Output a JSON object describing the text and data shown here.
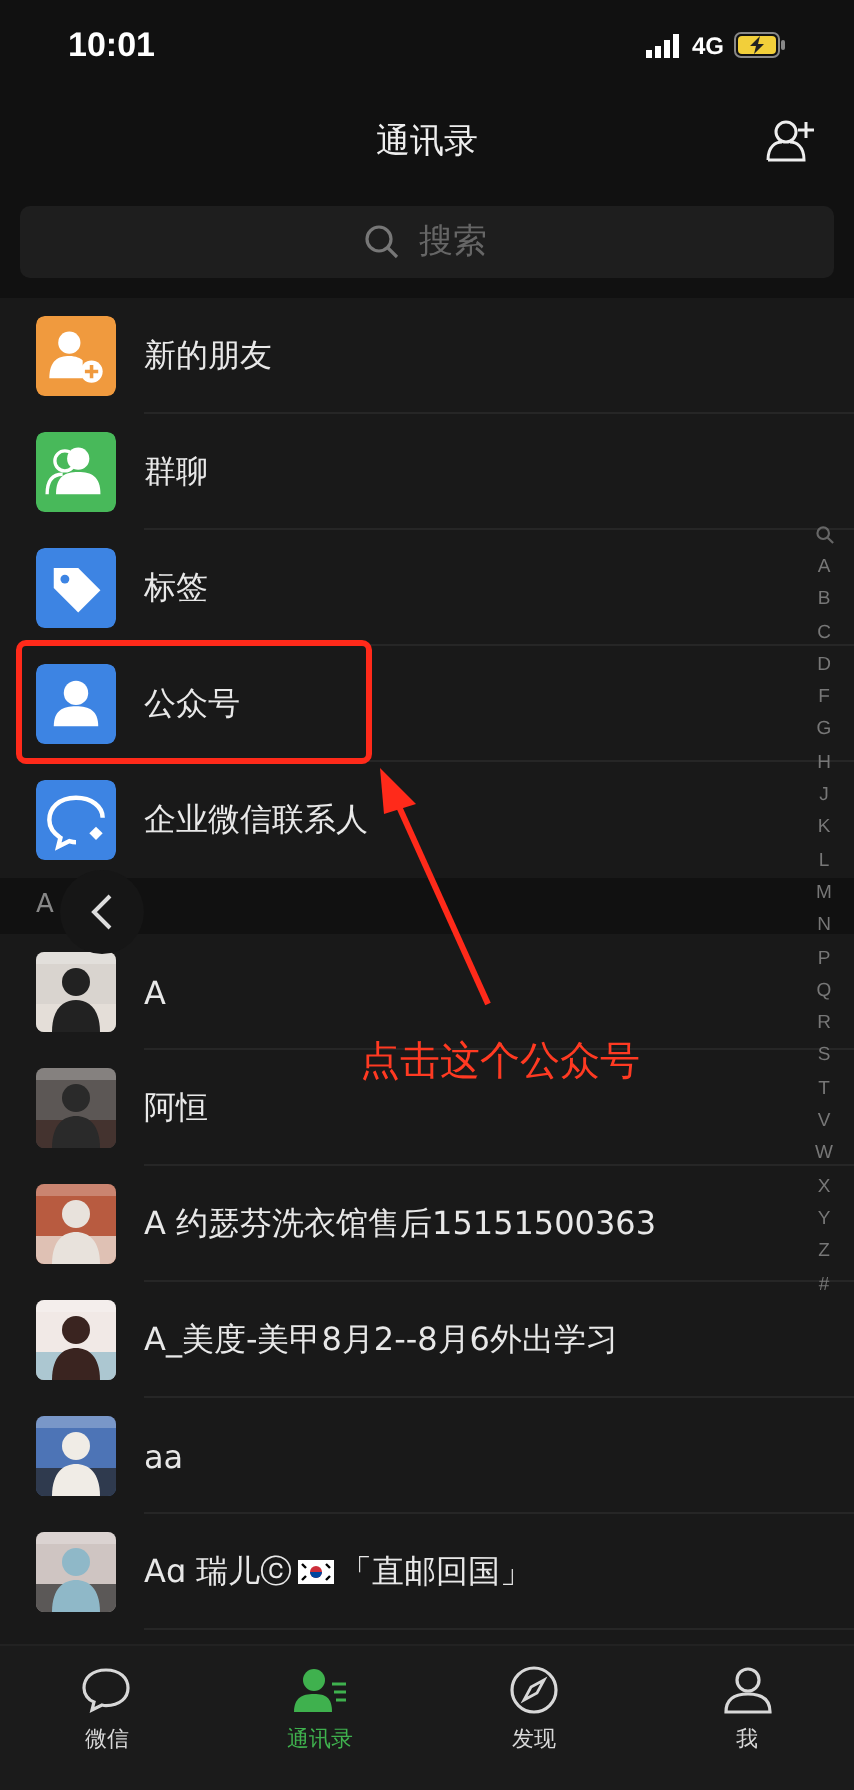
{
  "status_bar": {
    "time": "10:01",
    "network": "4G"
  },
  "nav": {
    "title": "通讯录"
  },
  "search": {
    "placeholder": "搜索"
  },
  "features": [
    {
      "label": "新的朋友",
      "kind": "new-friend",
      "color": "#f09a3e"
    },
    {
      "label": "群聊",
      "kind": "group",
      "color": "#48b95a"
    },
    {
      "label": "标签",
      "kind": "tag",
      "color": "#3d84e3"
    },
    {
      "label": "公众号",
      "kind": "official",
      "color": "#3d84e3"
    },
    {
      "label": "企业微信联系人",
      "kind": "work",
      "color": "#3d84e3"
    }
  ],
  "section_header": "A",
  "contacts": [
    {
      "name": "A",
      "kind": "picture"
    },
    {
      "name": "阿恒",
      "kind": "picture"
    },
    {
      "name": "A 约瑟芬洗衣馆售后15151500363",
      "kind": "picture"
    },
    {
      "name": "A_美度-美甲8月2--8月6外出学习",
      "kind": "picture"
    },
    {
      "name": "aa",
      "kind": "picture"
    },
    {
      "name": "Aɑ 瑞儿ⓒ",
      "flag": true,
      "name_after": "「直邮回国」",
      "kind": "picture"
    }
  ],
  "index_bar": [
    "A",
    "B",
    "C",
    "D",
    "F",
    "G",
    "H",
    "J",
    "K",
    "L",
    "M",
    "N",
    "P",
    "Q",
    "R",
    "S",
    "T",
    "V",
    "W",
    "X",
    "Y",
    "Z",
    "#"
  ],
  "annotation": {
    "text": "点击这个公众号"
  },
  "tabs": [
    {
      "label": "微信",
      "kind": "chats",
      "selected": false
    },
    {
      "label": "通讯录",
      "kind": "contacts",
      "selected": true
    },
    {
      "label": "发现",
      "kind": "discover",
      "selected": false
    },
    {
      "label": "我",
      "kind": "me",
      "selected": false
    }
  ]
}
